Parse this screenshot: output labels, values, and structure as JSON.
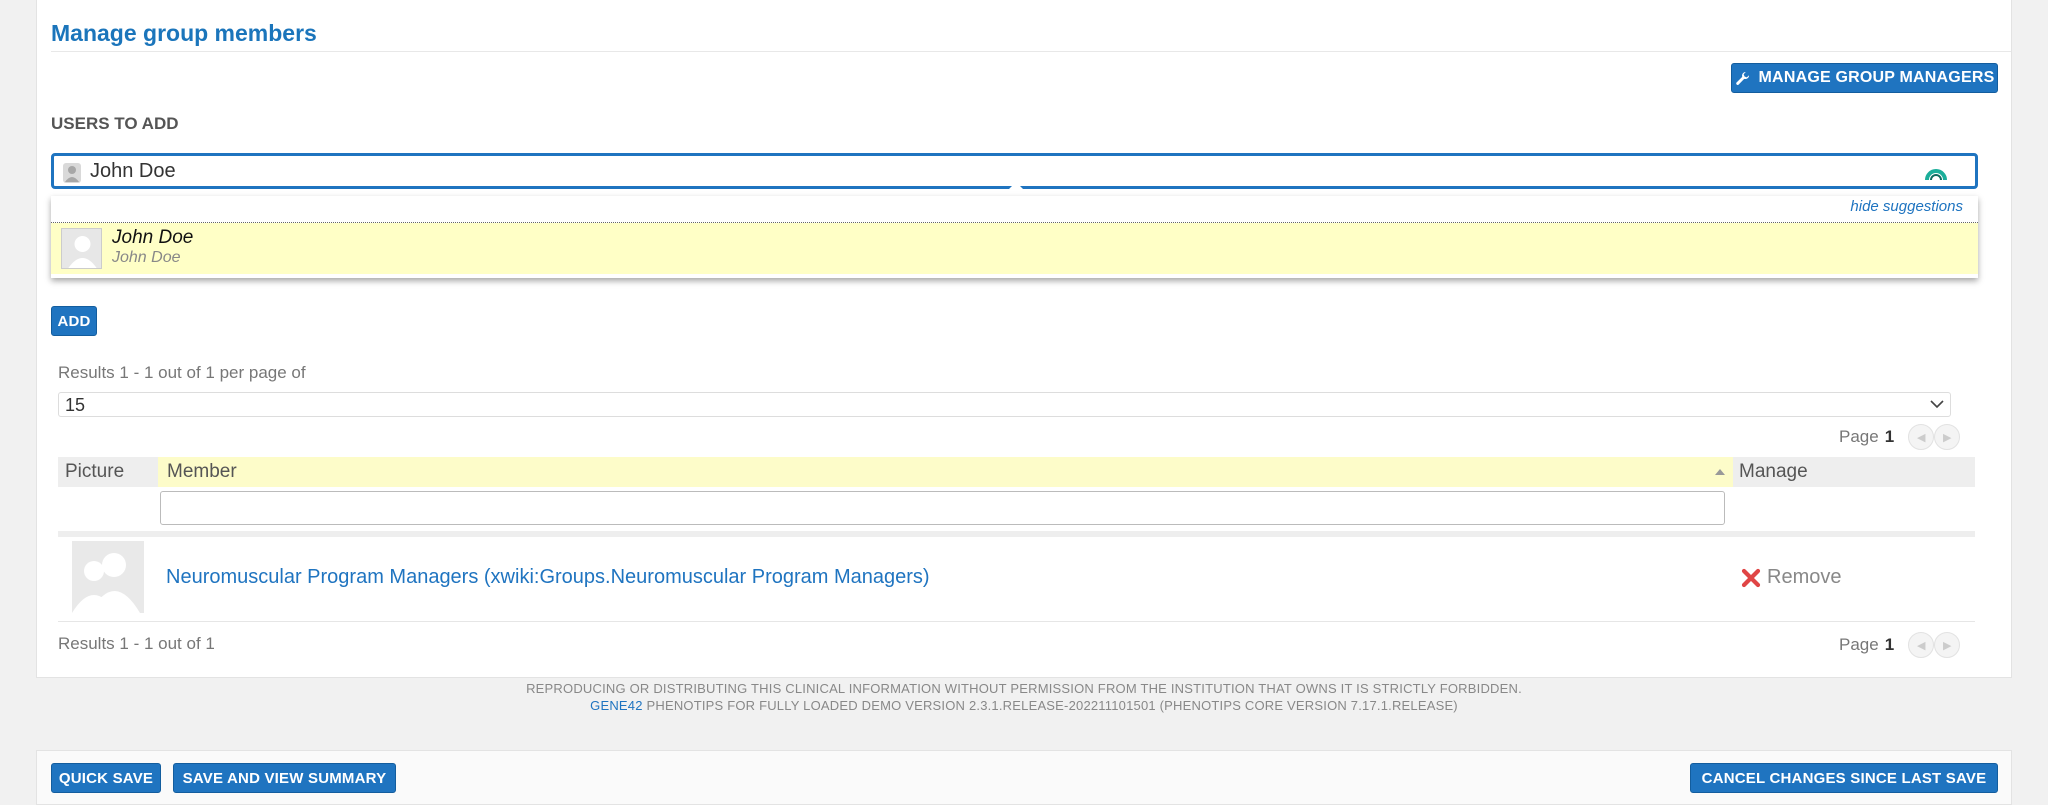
{
  "header": {
    "title": "Manage group members",
    "manage_managers_label": "MANAGE GROUP MANAGERS"
  },
  "add_users": {
    "label": "USERS TO ADD",
    "input_value": "John Doe",
    "hide_suggestions": "hide suggestions",
    "suggestion": {
      "name": "John  Doe",
      "subtitle": "John Doe"
    },
    "add_label": "ADD"
  },
  "table": {
    "results_top": "Results 1 - 1 out of 1  per page of",
    "per_page_value": "15",
    "page_label": "Page",
    "page_number": "1",
    "columns": {
      "picture": "Picture",
      "member": "Member",
      "manage": "Manage"
    },
    "rows": [
      {
        "member": "Neuromuscular Program Managers (xwiki:Groups.Neuromuscular Program Managers)",
        "action": "Remove"
      }
    ],
    "results_bottom": "Results 1 - 1 out of 1"
  },
  "footer": {
    "notice": "REPRODUCING OR DISTRIBUTING THIS CLINICAL INFORMATION WITHOUT PERMISSION FROM THE INSTITUTION THAT OWNS IT IS STRICTLY FORBIDDEN.",
    "brand": "GENE42",
    "version": " PHENOTIPS FOR FULLY LOADED DEMO VERSION 2.3.1.RELEASE-202211101501 (PHENOTIPS CORE VERSION 7.17.1.RELEASE)"
  },
  "actions": {
    "quick_save": "QUICK SAVE",
    "save_view": "SAVE AND VIEW SUMMARY",
    "cancel": "CANCEL CHANGES SINCE LAST SAVE"
  },
  "colors": {
    "accent": "#1f74c0",
    "highlight": "#ffffc6",
    "danger": "#e04545"
  }
}
